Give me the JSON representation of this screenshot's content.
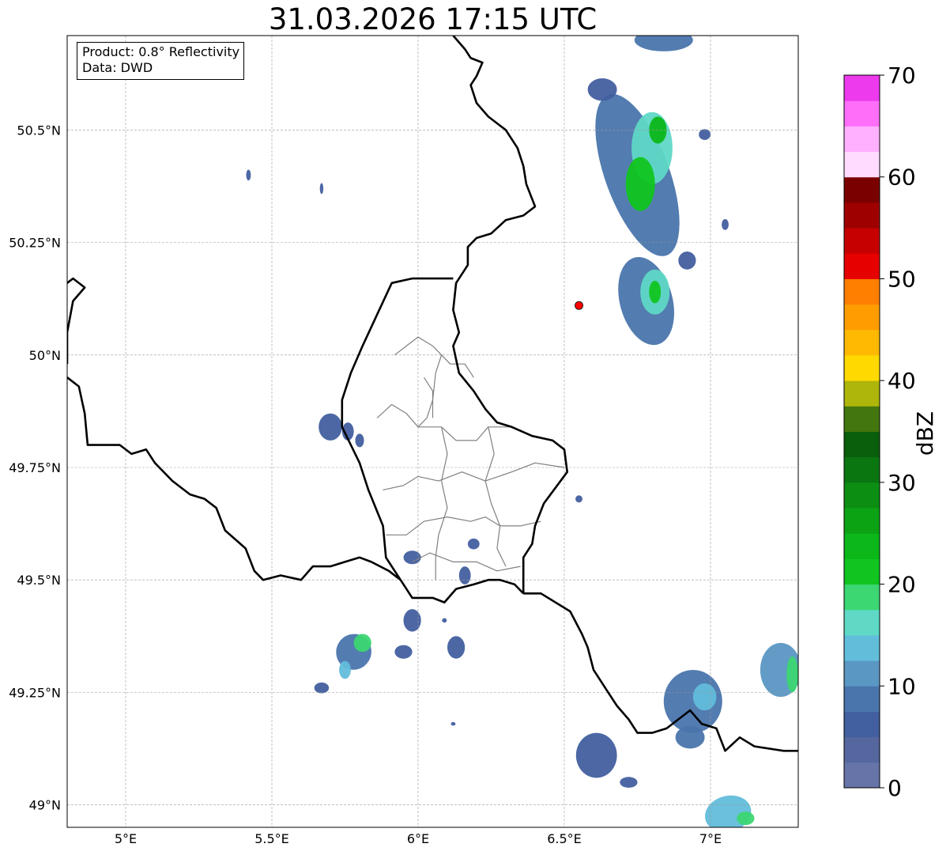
{
  "map": {
    "title": "31.03.2026 17:15 UTC",
    "info_box": {
      "product": "Product: 0.8° Reflectivity",
      "data_source": "Data: DWD"
    },
    "extent": {
      "lon_min": 4.8,
      "lon_max": 7.3,
      "lat_min": 48.95,
      "lat_max": 50.71
    },
    "lon_ticks": [
      {
        "value": 5.0,
        "label": "5°E"
      },
      {
        "value": 5.5,
        "label": "5.5°E"
      },
      {
        "value": 6.0,
        "label": "6°E"
      },
      {
        "value": 6.5,
        "label": "6.5°E"
      },
      {
        "value": 7.0,
        "label": "7°E"
      }
    ],
    "lat_ticks": [
      {
        "value": 49.0,
        "label": "49°N"
      },
      {
        "value": 49.25,
        "label": "49.25°N"
      },
      {
        "value": 49.5,
        "label": "49.5°N"
      },
      {
        "value": 49.75,
        "label": "49.75°N"
      },
      {
        "value": 50.0,
        "label": "50°N"
      },
      {
        "value": 50.25,
        "label": "50.25°N"
      },
      {
        "value": 50.5,
        "label": "50.5°N"
      }
    ],
    "gridlines": true,
    "radar_site": {
      "lon": 6.55,
      "lat": 50.11,
      "color": "#ff0000"
    },
    "colorbar": {
      "label": "dBZ",
      "min": 0,
      "max": 70,
      "step": 2.5,
      "tick_values": [
        0,
        10,
        20,
        30,
        40,
        50,
        60,
        70
      ],
      "colors": [
        "#6674a8",
        "#56679f",
        "#425f9f",
        "#4a75ac",
        "#5a97c3",
        "#62bddb",
        "#5fd8c6",
        "#3cd672",
        "#10c51f",
        "#0cb71a",
        "#0ba314",
        "#0c8e12",
        "#0a7610",
        "#095f0b",
        "#43760e",
        "#aeb50b",
        "#ffd900",
        "#ffb900",
        "#ff9d00",
        "#ff7f00",
        "#e60000",
        "#c60000",
        "#9e0000",
        "#7a0000",
        "#ffdcff",
        "#ffb0ff",
        "#ff6ef9",
        "#ec3aec"
      ]
    },
    "borders": {
      "country_color": "#000000",
      "district_color": "#808080",
      "country_lines": [
        [
          [
            6.12,
            50.71
          ],
          [
            6.16,
            50.68
          ],
          [
            6.18,
            50.66
          ],
          [
            6.22,
            50.65
          ],
          [
            6.2,
            50.62
          ],
          [
            6.18,
            50.6
          ],
          [
            6.2,
            50.56
          ],
          [
            6.24,
            50.53
          ],
          [
            6.3,
            50.5
          ],
          [
            6.34,
            50.46
          ],
          [
            6.36,
            50.42
          ],
          [
            6.37,
            50.38
          ],
          [
            6.4,
            50.33
          ],
          [
            6.36,
            50.31
          ],
          [
            6.3,
            50.3
          ],
          [
            6.25,
            50.27
          ],
          [
            6.2,
            50.26
          ],
          [
            6.17,
            50.24
          ],
          [
            6.17,
            50.2
          ],
          [
            6.13,
            50.16
          ],
          [
            6.12,
            50.1
          ],
          [
            6.14,
            50.05
          ],
          [
            6.12,
            50.02
          ],
          [
            6.14,
            49.96
          ],
          [
            6.19,
            49.92
          ],
          [
            6.23,
            49.88
          ],
          [
            6.27,
            49.85
          ],
          [
            6.32,
            49.84
          ],
          [
            6.39,
            49.82
          ],
          [
            6.46,
            49.81
          ],
          [
            6.5,
            49.79
          ],
          [
            6.51,
            49.74
          ],
          [
            6.43,
            49.67
          ],
          [
            6.4,
            49.62
          ],
          [
            6.39,
            49.58
          ],
          [
            6.36,
            49.55
          ],
          [
            6.36,
            49.47
          ]
        ],
        [
          [
            6.36,
            49.47
          ],
          [
            6.33,
            49.49
          ],
          [
            6.28,
            49.5
          ],
          [
            6.24,
            49.5
          ],
          [
            6.19,
            49.49
          ],
          [
            6.13,
            49.48
          ],
          [
            6.09,
            49.45
          ],
          [
            6.05,
            49.46
          ],
          [
            5.98,
            49.46
          ],
          [
            5.94,
            49.5
          ]
        ],
        [
          [
            5.94,
            49.5
          ],
          [
            5.9,
            49.52
          ],
          [
            5.84,
            49.54
          ],
          [
            5.8,
            49.55
          ],
          [
            5.75,
            49.54
          ],
          [
            5.7,
            49.53
          ],
          [
            5.64,
            49.53
          ],
          [
            5.6,
            49.5
          ],
          [
            5.53,
            49.51
          ],
          [
            5.47,
            49.5
          ],
          [
            5.44,
            49.52
          ],
          [
            5.41,
            49.57
          ],
          [
            5.34,
            49.61
          ],
          [
            5.31,
            49.66
          ],
          [
            5.27,
            49.68
          ],
          [
            5.22,
            49.69
          ],
          [
            5.16,
            49.72
          ],
          [
            5.1,
            49.76
          ],
          [
            5.07,
            49.79
          ],
          [
            5.02,
            49.78
          ],
          [
            4.98,
            49.8
          ],
          [
            4.94,
            49.8
          ],
          [
            4.87,
            49.8
          ],
          [
            4.86,
            49.87
          ],
          [
            4.84,
            49.93
          ],
          [
            4.8,
            49.95
          ]
        ],
        [
          [
            5.94,
            49.5
          ],
          [
            5.89,
            49.55
          ],
          [
            5.88,
            49.62
          ],
          [
            5.83,
            49.7
          ],
          [
            5.8,
            49.76
          ],
          [
            5.74,
            49.84
          ],
          [
            5.74,
            49.9
          ],
          [
            5.77,
            49.96
          ],
          [
            5.81,
            50.02
          ],
          [
            5.86,
            50.09
          ],
          [
            5.91,
            50.16
          ],
          [
            5.98,
            50.17
          ],
          [
            6.02,
            50.17
          ],
          [
            6.12,
            50.17
          ]
        ],
        [
          [
            6.36,
            49.47
          ],
          [
            6.42,
            49.47
          ],
          [
            6.52,
            49.43
          ],
          [
            6.56,
            49.38
          ],
          [
            6.58,
            49.35
          ],
          [
            6.6,
            49.3
          ],
          [
            6.65,
            49.25
          ],
          [
            6.68,
            49.22
          ],
          [
            6.72,
            49.19
          ],
          [
            6.75,
            49.16
          ],
          [
            6.8,
            49.16
          ],
          [
            6.85,
            49.17
          ],
          [
            6.93,
            49.21
          ],
          [
            6.97,
            49.18
          ],
          [
            7.02,
            49.17
          ],
          [
            7.05,
            49.12
          ],
          [
            7.1,
            49.15
          ],
          [
            7.15,
            49.13
          ],
          [
            7.25,
            49.12
          ],
          [
            7.3,
            49.12
          ]
        ],
        [
          [
            4.8,
            50.16
          ],
          [
            4.82,
            50.17
          ],
          [
            4.86,
            50.15
          ],
          [
            4.82,
            50.12
          ],
          [
            4.8,
            50.05
          ],
          [
            4.8,
            49.98
          ]
        ]
      ],
      "district_lines": [
        [
          [
            5.86,
            49.86
          ],
          [
            5.91,
            49.89
          ],
          [
            5.96,
            49.87
          ],
          [
            6.0,
            49.84
          ],
          [
            6.08,
            49.84
          ],
          [
            6.13,
            49.81
          ],
          [
            6.2,
            49.81
          ],
          [
            6.24,
            49.84
          ],
          [
            6.32,
            49.84
          ]
        ],
        [
          [
            5.92,
            50.0
          ],
          [
            5.96,
            50.02
          ],
          [
            6.0,
            50.04
          ],
          [
            6.05,
            50.02
          ],
          [
            6.08,
            50.0
          ]
        ],
        [
          [
            6.08,
            50.0
          ],
          [
            6.06,
            49.96
          ],
          [
            6.05,
            49.9
          ],
          [
            6.03,
            49.86
          ],
          [
            6.0,
            49.84
          ]
        ],
        [
          [
            6.08,
            50.0
          ],
          [
            6.11,
            49.98
          ],
          [
            6.16,
            49.98
          ],
          [
            6.19,
            49.95
          ]
        ],
        [
          [
            6.08,
            49.84
          ],
          [
            6.1,
            49.78
          ],
          [
            6.08,
            49.72
          ],
          [
            6.1,
            49.66
          ],
          [
            6.07,
            49.6
          ],
          [
            6.06,
            49.55
          ],
          [
            6.06,
            49.5
          ]
        ],
        [
          [
            6.24,
            49.84
          ],
          [
            6.26,
            49.78
          ],
          [
            6.23,
            49.72
          ],
          [
            6.25,
            49.67
          ],
          [
            6.28,
            49.62
          ],
          [
            6.27,
            49.57
          ],
          [
            6.3,
            49.53
          ]
        ],
        [
          [
            5.88,
            49.7
          ],
          [
            5.95,
            49.71
          ],
          [
            6.0,
            49.73
          ],
          [
            6.07,
            49.72
          ],
          [
            6.15,
            49.74
          ],
          [
            6.23,
            49.72
          ],
          [
            6.32,
            49.74
          ],
          [
            6.4,
            49.76
          ],
          [
            6.5,
            49.75
          ]
        ],
        [
          [
            5.89,
            49.6
          ],
          [
            5.96,
            49.6
          ],
          [
            6.02,
            49.63
          ],
          [
            6.1,
            49.64
          ],
          [
            6.18,
            49.63
          ],
          [
            6.23,
            49.64
          ],
          [
            6.28,
            49.62
          ],
          [
            6.35,
            49.62
          ],
          [
            6.42,
            49.63
          ]
        ],
        [
          [
            5.98,
            49.54
          ],
          [
            6.04,
            49.56
          ],
          [
            6.12,
            49.54
          ],
          [
            6.2,
            49.54
          ],
          [
            6.27,
            49.52
          ],
          [
            6.35,
            49.53
          ]
        ],
        [
          [
            6.02,
            49.95
          ],
          [
            6.05,
            49.92
          ],
          [
            6.05,
            49.86
          ]
        ]
      ]
    },
    "echo_cells": [
      {
        "lon": 6.75,
        "lat": 50.4,
        "rlon": 0.11,
        "rlat": 0.19,
        "level": 3,
        "rot": -20
      },
      {
        "lon": 6.8,
        "lat": 50.46,
        "rlon": 0.07,
        "rlat": 0.08,
        "level": 6
      },
      {
        "lon": 6.76,
        "lat": 50.38,
        "rlon": 0.05,
        "rlat": 0.06,
        "level": 8
      },
      {
        "lon": 6.82,
        "lat": 50.5,
        "rlon": 0.03,
        "rlat": 0.03,
        "level": 9
      },
      {
        "lon": 6.84,
        "lat": 50.7,
        "rlon": 0.1,
        "rlat": 0.025,
        "level": 3
      },
      {
        "lon": 6.63,
        "lat": 50.59,
        "rlon": 0.05,
        "rlat": 0.025,
        "level": 2
      },
      {
        "lon": 6.98,
        "lat": 50.49,
        "rlon": 0.02,
        "rlat": 0.012,
        "level": 2
      },
      {
        "lon": 6.78,
        "lat": 50.12,
        "rlon": 0.09,
        "rlat": 0.1,
        "level": 3,
        "rot": -15
      },
      {
        "lon": 6.81,
        "lat": 50.14,
        "rlon": 0.05,
        "rlat": 0.05,
        "level": 6
      },
      {
        "lon": 6.81,
        "lat": 50.14,
        "rlon": 0.02,
        "rlat": 0.025,
        "level": 8
      },
      {
        "lon": 6.92,
        "lat": 50.21,
        "rlon": 0.03,
        "rlat": 0.02,
        "level": 2
      },
      {
        "lon": 7.05,
        "lat": 50.29,
        "rlon": 0.012,
        "rlat": 0.012,
        "level": 2
      },
      {
        "lon": 5.7,
        "lat": 49.84,
        "rlon": 0.04,
        "rlat": 0.03,
        "level": 2
      },
      {
        "lon": 5.76,
        "lat": 49.83,
        "rlon": 0.02,
        "rlat": 0.02,
        "level": 2
      },
      {
        "lon": 5.8,
        "lat": 49.81,
        "rlon": 0.015,
        "rlat": 0.015,
        "level": 2
      },
      {
        "lon": 5.98,
        "lat": 49.55,
        "rlon": 0.03,
        "rlat": 0.015,
        "level": 2
      },
      {
        "lon": 6.16,
        "lat": 49.51,
        "rlon": 0.02,
        "rlat": 0.02,
        "level": 2
      },
      {
        "lon": 6.19,
        "lat": 49.58,
        "rlon": 0.02,
        "rlat": 0.012,
        "level": 2
      },
      {
        "lon": 5.78,
        "lat": 49.34,
        "rlon": 0.06,
        "rlat": 0.04,
        "level": 3,
        "rot": 30
      },
      {
        "lon": 5.81,
        "lat": 49.36,
        "rlon": 0.03,
        "rlat": 0.02,
        "level": 7
      },
      {
        "lon": 5.75,
        "lat": 49.3,
        "rlon": 0.02,
        "rlat": 0.02,
        "level": 5
      },
      {
        "lon": 5.67,
        "lat": 49.26,
        "rlon": 0.025,
        "rlat": 0.012,
        "level": 2
      },
      {
        "lon": 5.95,
        "lat": 49.34,
        "rlon": 0.03,
        "rlat": 0.015,
        "level": 2
      },
      {
        "lon": 5.98,
        "lat": 49.41,
        "rlon": 0.03,
        "rlat": 0.025,
        "level": 2
      },
      {
        "lon": 6.13,
        "lat": 49.35,
        "rlon": 0.03,
        "rlat": 0.025,
        "level": 2
      },
      {
        "lon": 6.61,
        "lat": 49.11,
        "rlon": 0.07,
        "rlat": 0.05,
        "level": 2
      },
      {
        "lon": 6.72,
        "lat": 49.05,
        "rlon": 0.03,
        "rlat": 0.012,
        "level": 2
      },
      {
        "lon": 6.94,
        "lat": 49.23,
        "rlon": 0.1,
        "rlat": 0.07,
        "level": 3
      },
      {
        "lon": 6.98,
        "lat": 49.24,
        "rlon": 0.04,
        "rlat": 0.03,
        "level": 5
      },
      {
        "lon": 6.93,
        "lat": 49.15,
        "rlon": 0.05,
        "rlat": 0.025,
        "level": 3
      },
      {
        "lon": 7.24,
        "lat": 49.3,
        "rlon": 0.07,
        "rlat": 0.06,
        "level": 4
      },
      {
        "lon": 7.28,
        "lat": 49.29,
        "rlon": 0.02,
        "rlat": 0.04,
        "level": 7
      },
      {
        "lon": 7.06,
        "lat": 48.98,
        "rlon": 0.08,
        "rlat": 0.04,
        "level": 5,
        "rot": -15
      },
      {
        "lon": 7.12,
        "lat": 48.97,
        "rlon": 0.03,
        "rlat": 0.015,
        "level": 7
      },
      {
        "lon": 5.42,
        "lat": 50.4,
        "rlon": 0.008,
        "rlat": 0.012,
        "level": 2
      },
      {
        "lon": 5.67,
        "lat": 50.37,
        "rlon": 0.006,
        "rlat": 0.012,
        "level": 2
      },
      {
        "lon": 6.55,
        "lat": 49.68,
        "rlon": 0.012,
        "rlat": 0.008,
        "level": 2
      },
      {
        "lon": 6.09,
        "lat": 49.41,
        "rlon": 0.008,
        "rlat": 0.005,
        "level": 2
      },
      {
        "lon": 6.12,
        "lat": 49.18,
        "rlon": 0.008,
        "rlat": 0.004,
        "level": 2
      }
    ]
  }
}
